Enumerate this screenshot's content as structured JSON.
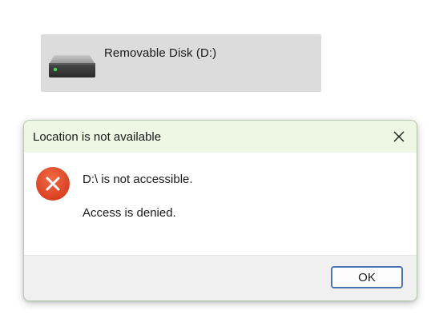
{
  "drive": {
    "label": "Removable Disk (D:)",
    "icon": "removable-drive-icon",
    "led_color": "#3ddc5a"
  },
  "dialog": {
    "title": "Location is not available",
    "close_icon": "close-icon",
    "error_icon": "error-icon",
    "message_primary": "D:\\ is not accessible.",
    "message_secondary": "Access is denied.",
    "ok_label": "OK"
  },
  "colors": {
    "titlebar_bg": "#eef7e4",
    "error_red": "#e0452a",
    "button_border": "#4a74b8"
  }
}
